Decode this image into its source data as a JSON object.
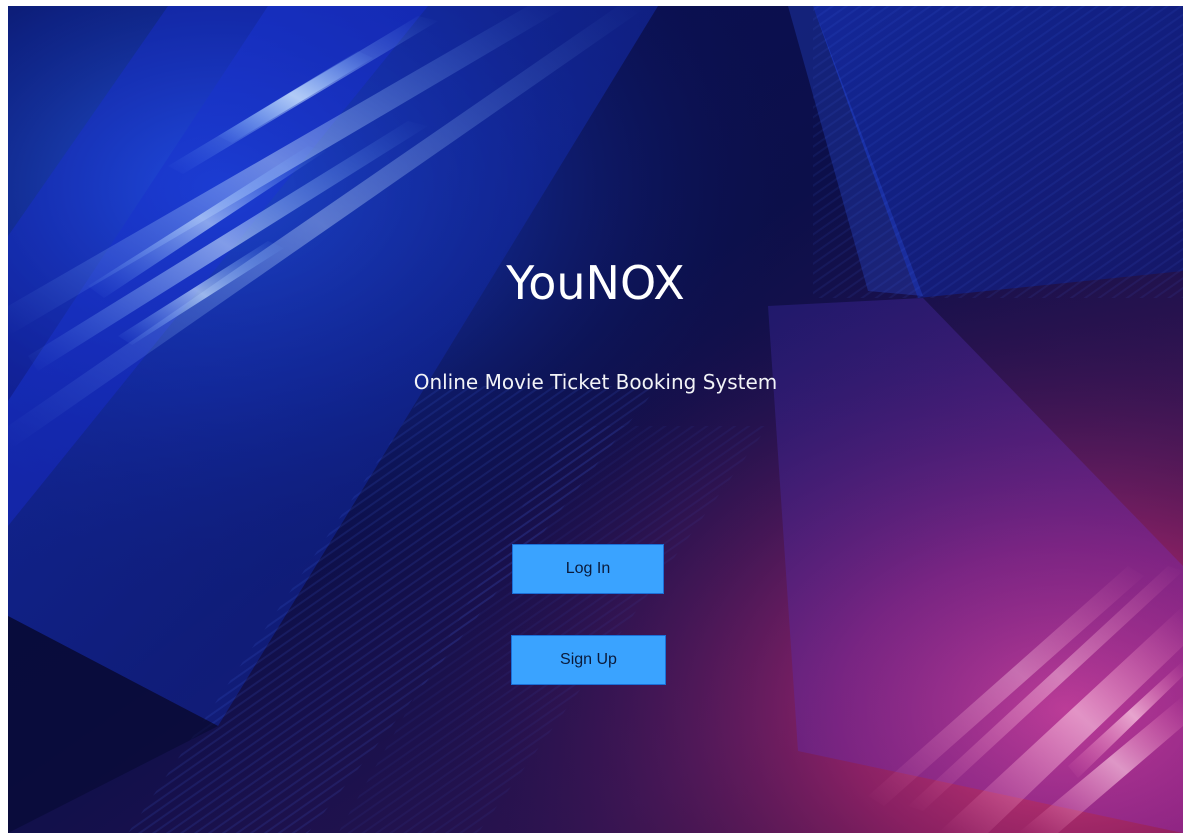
{
  "app": {
    "title": "YouNOX",
    "subtitle": "Online Movie Ticket Booking System"
  },
  "actions": {
    "login_label": "Log In",
    "signup_label": "Sign Up"
  },
  "colors": {
    "background_dark": "#0b0f45",
    "accent_blue": "#2d6bff",
    "accent_pink": "#ff3d7f",
    "button_fill": "#3aa3ff",
    "button_border": "#1b6fd8",
    "text": "#ffffff"
  }
}
